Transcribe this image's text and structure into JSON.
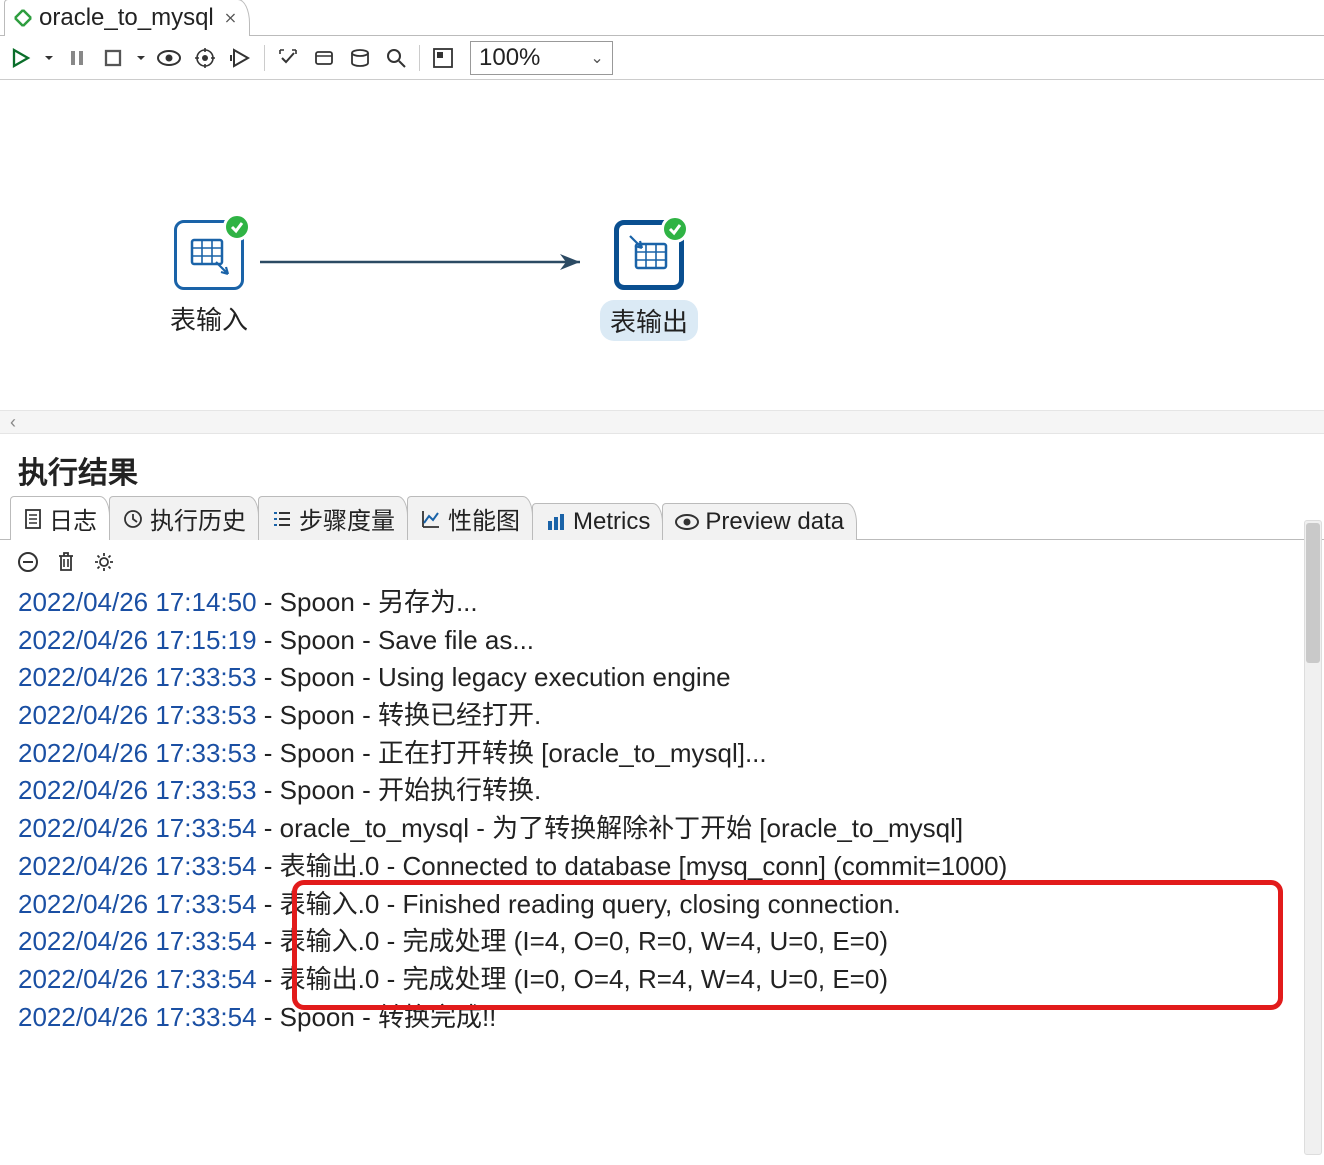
{
  "tab": {
    "title": "oracle_to_mysql",
    "close_glyph": "⨯"
  },
  "toolbar": {
    "zoom_value": "100%"
  },
  "canvas": {
    "step_input_label": "表输入",
    "step_output_label": "表输出"
  },
  "scroll_hint": "‹",
  "results": {
    "title": "执行结果",
    "tabs": {
      "log": "日志",
      "history": "执行历史",
      "step_metrics": "步骤度量",
      "perf": "性能图",
      "metrics": "Metrics",
      "preview": "Preview data"
    }
  },
  "log": [
    {
      "ts": "2022/04/26 17:14:50",
      "msg": "Spoon - 另存为..."
    },
    {
      "ts": "2022/04/26 17:15:19",
      "msg": "Spoon - Save file as..."
    },
    {
      "ts": "2022/04/26 17:33:53",
      "msg": "Spoon - Using legacy execution engine"
    },
    {
      "ts": "2022/04/26 17:33:53",
      "msg": "Spoon - 转换已经打开."
    },
    {
      "ts": "2022/04/26 17:33:53",
      "msg": "Spoon - 正在打开转换 [oracle_to_mysql]..."
    },
    {
      "ts": "2022/04/26 17:33:53",
      "msg": "Spoon - 开始执行转换."
    },
    {
      "ts": "2022/04/26 17:33:54",
      "msg": "oracle_to_mysql - 为了转换解除补丁开始  [oracle_to_mysql]"
    },
    {
      "ts": "2022/04/26 17:33:54",
      "msg": "表输出.0 - Connected to database [mysq_conn] (commit=1000)"
    },
    {
      "ts": "2022/04/26 17:33:54",
      "msg": "表输入.0 - Finished reading query, closing connection."
    },
    {
      "ts": "2022/04/26 17:33:54",
      "msg": "表输入.0 - 完成处理 (I=4, O=0, R=0, W=4, U=0, E=0)"
    },
    {
      "ts": "2022/04/26 17:33:54",
      "msg": "表输出.0 - 完成处理 (I=0, O=4, R=4, W=4, U=0, E=0)"
    },
    {
      "ts": "2022/04/26 17:33:54",
      "msg": "Spoon - 转换完成!!"
    }
  ]
}
